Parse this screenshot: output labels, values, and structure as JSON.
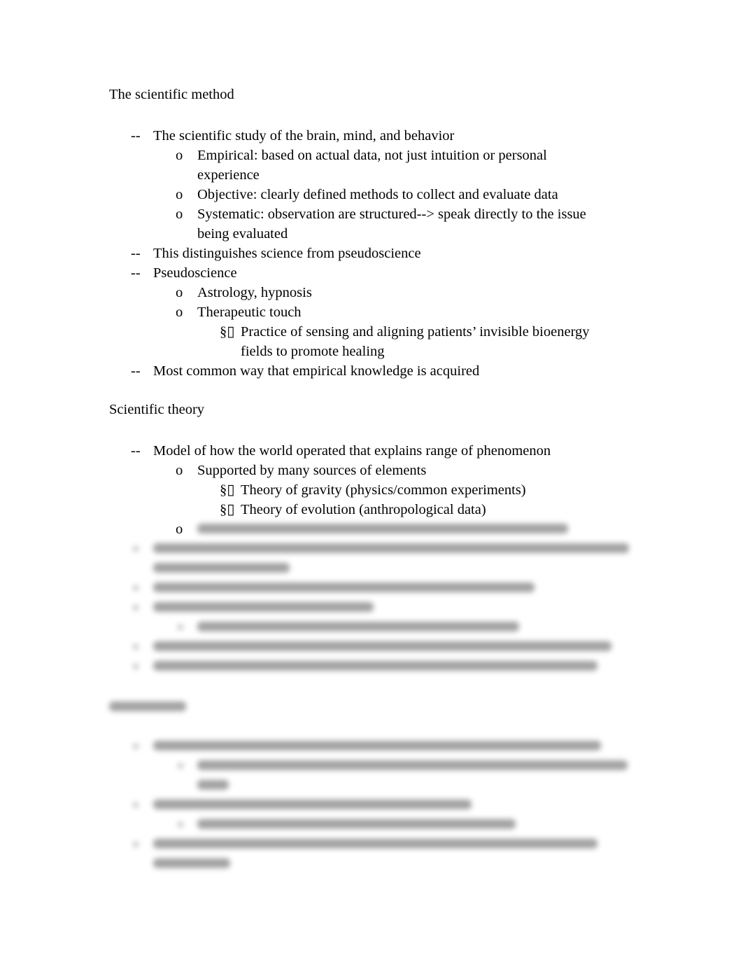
{
  "sections": [
    {
      "heading": "The scientific method",
      "items": [
        {
          "level": 1,
          "marker": "--",
          "lines": [
            "The scientific study of the brain, mind, and behavior"
          ]
        },
        {
          "level": 2,
          "marker": "o",
          "lines": [
            "Empirical: based on actual data, not just intuition or personal",
            "experience"
          ]
        },
        {
          "level": 2,
          "marker": "o",
          "lines": [
            "Objective: clearly defined methods to collect and evaluate data"
          ]
        },
        {
          "level": 2,
          "marker": "o",
          "lines": [
            "Systematic: observation are structured--> speak directly to the issue",
            "being evaluated"
          ]
        },
        {
          "level": 1,
          "marker": "--",
          "lines": [
            "This distinguishes science from pseudoscience"
          ]
        },
        {
          "level": 1,
          "marker": "--",
          "lines": [
            "Pseudoscience"
          ]
        },
        {
          "level": 2,
          "marker": "o",
          "lines": [
            "Astrology, hypnosis"
          ]
        },
        {
          "level": 2,
          "marker": "o",
          "lines": [
            "Therapeutic touch"
          ]
        },
        {
          "level": 3,
          "marker": "§▯",
          "lines": [
            "Practice of sensing and aligning patients’ invisible bioenergy",
            "fields to promote healing"
          ]
        },
        {
          "level": 1,
          "marker": "--",
          "lines": [
            "Most common way that empirical knowledge is acquired"
          ]
        }
      ]
    },
    {
      "heading": "Scientific theory",
      "items": [
        {
          "level": 1,
          "marker": "--",
          "lines": [
            "Model of how the world operated that explains range of phenomenon"
          ]
        },
        {
          "level": 2,
          "marker": "o",
          "lines": [
            "Supported by many sources of elements"
          ]
        },
        {
          "level": 3,
          "marker": "§▯",
          "lines": [
            "Theory of gravity (physics/common experiments)"
          ]
        },
        {
          "level": 3,
          "marker": "§▯",
          "lines": [
            "Theory of evolution (anthropological data)"
          ]
        },
        {
          "level": 2,
          "marker": "o",
          "lines": [
            ""
          ]
        }
      ]
    }
  ],
  "blurred_preview": {
    "note": "Remaining content is blurred and not legible"
  }
}
